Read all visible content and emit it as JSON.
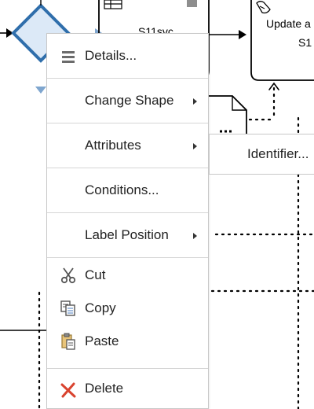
{
  "canvas": {
    "task_label_1": "S11svc",
    "task_label_2_line1": "Update a",
    "task_label_2_line2": "S1"
  },
  "context_menu": {
    "items": [
      {
        "label": "Details...",
        "icon": "details-icon"
      },
      {
        "label": "Change Shape",
        "has_submenu": true
      },
      {
        "label": "Attributes",
        "has_submenu": true
      },
      {
        "label": "Conditions..."
      },
      {
        "label": "Label Position",
        "has_submenu": true
      },
      {
        "label": "Cut",
        "icon": "scissors-icon"
      },
      {
        "label": "Copy",
        "icon": "copy-icon"
      },
      {
        "label": "Paste",
        "icon": "paste-icon"
      },
      {
        "label": "Delete",
        "icon": "delete-icon"
      }
    ]
  },
  "submenu": {
    "items": [
      {
        "label": "Identifier..."
      }
    ]
  },
  "colors": {
    "gateway_fill": "#dce9f7",
    "gateway_stroke": "#2f6eab",
    "delete_red": "#d9432f"
  }
}
